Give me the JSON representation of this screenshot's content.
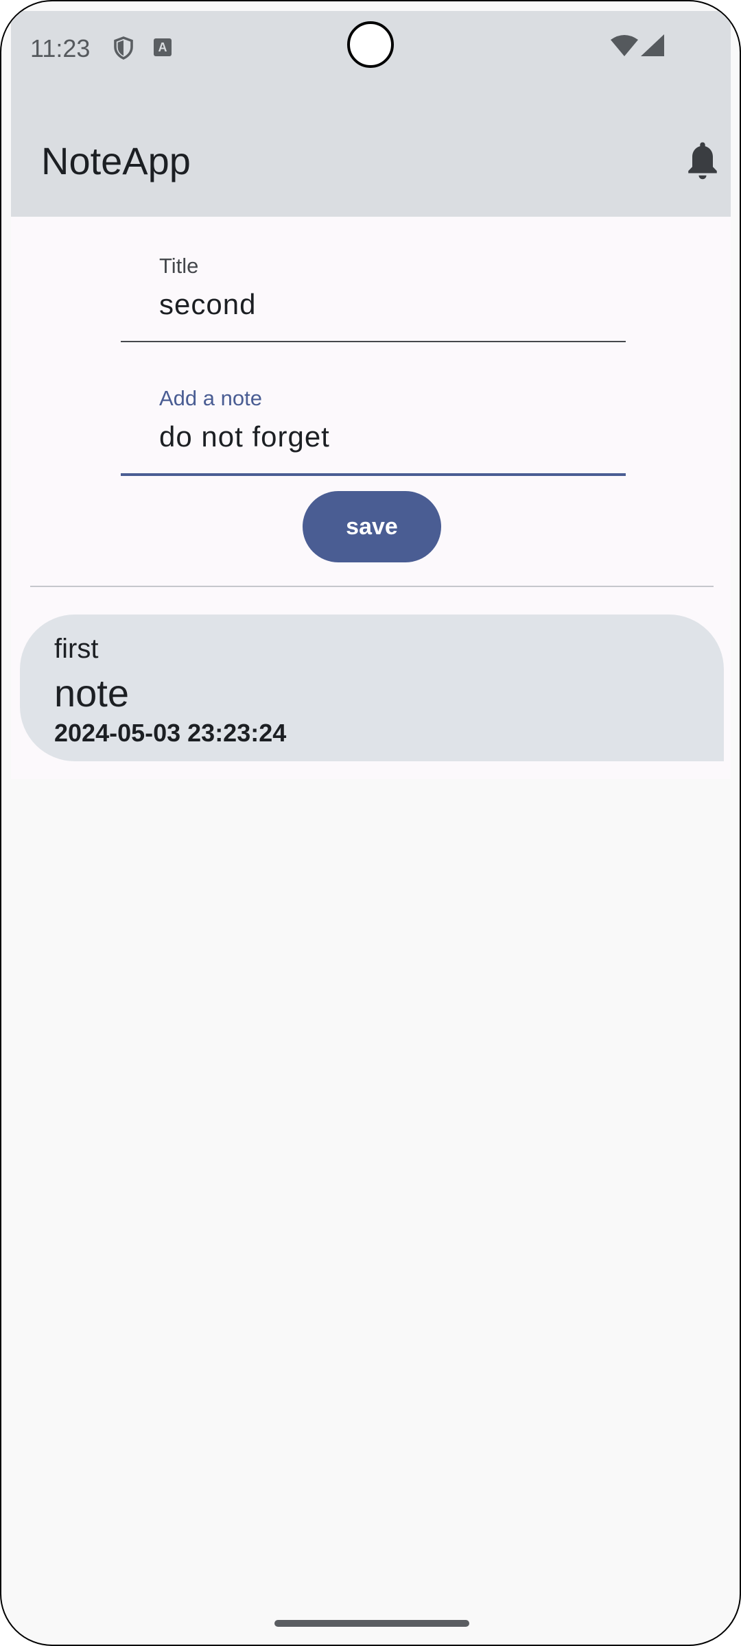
{
  "status_bar": {
    "time": "11:23",
    "icons": [
      "shield-icon",
      "a-box-icon",
      "wifi-icon",
      "signal-icon"
    ]
  },
  "app_bar": {
    "title": "NoteApp",
    "action_icon": "bell-icon"
  },
  "form": {
    "title_field": {
      "label": "Title",
      "value": "second"
    },
    "note_field": {
      "label": "Add a note",
      "value": "do not forget"
    },
    "save_label": "save"
  },
  "notes": [
    {
      "title": "first",
      "body": "note",
      "timestamp": "2024-05-03 23:23:24"
    }
  ],
  "colors": {
    "app_bar_bg": "#dadde1",
    "content_bg": "#fcf9fc",
    "accent": "#4a5d93",
    "card_bg": "#dfe3e8"
  }
}
